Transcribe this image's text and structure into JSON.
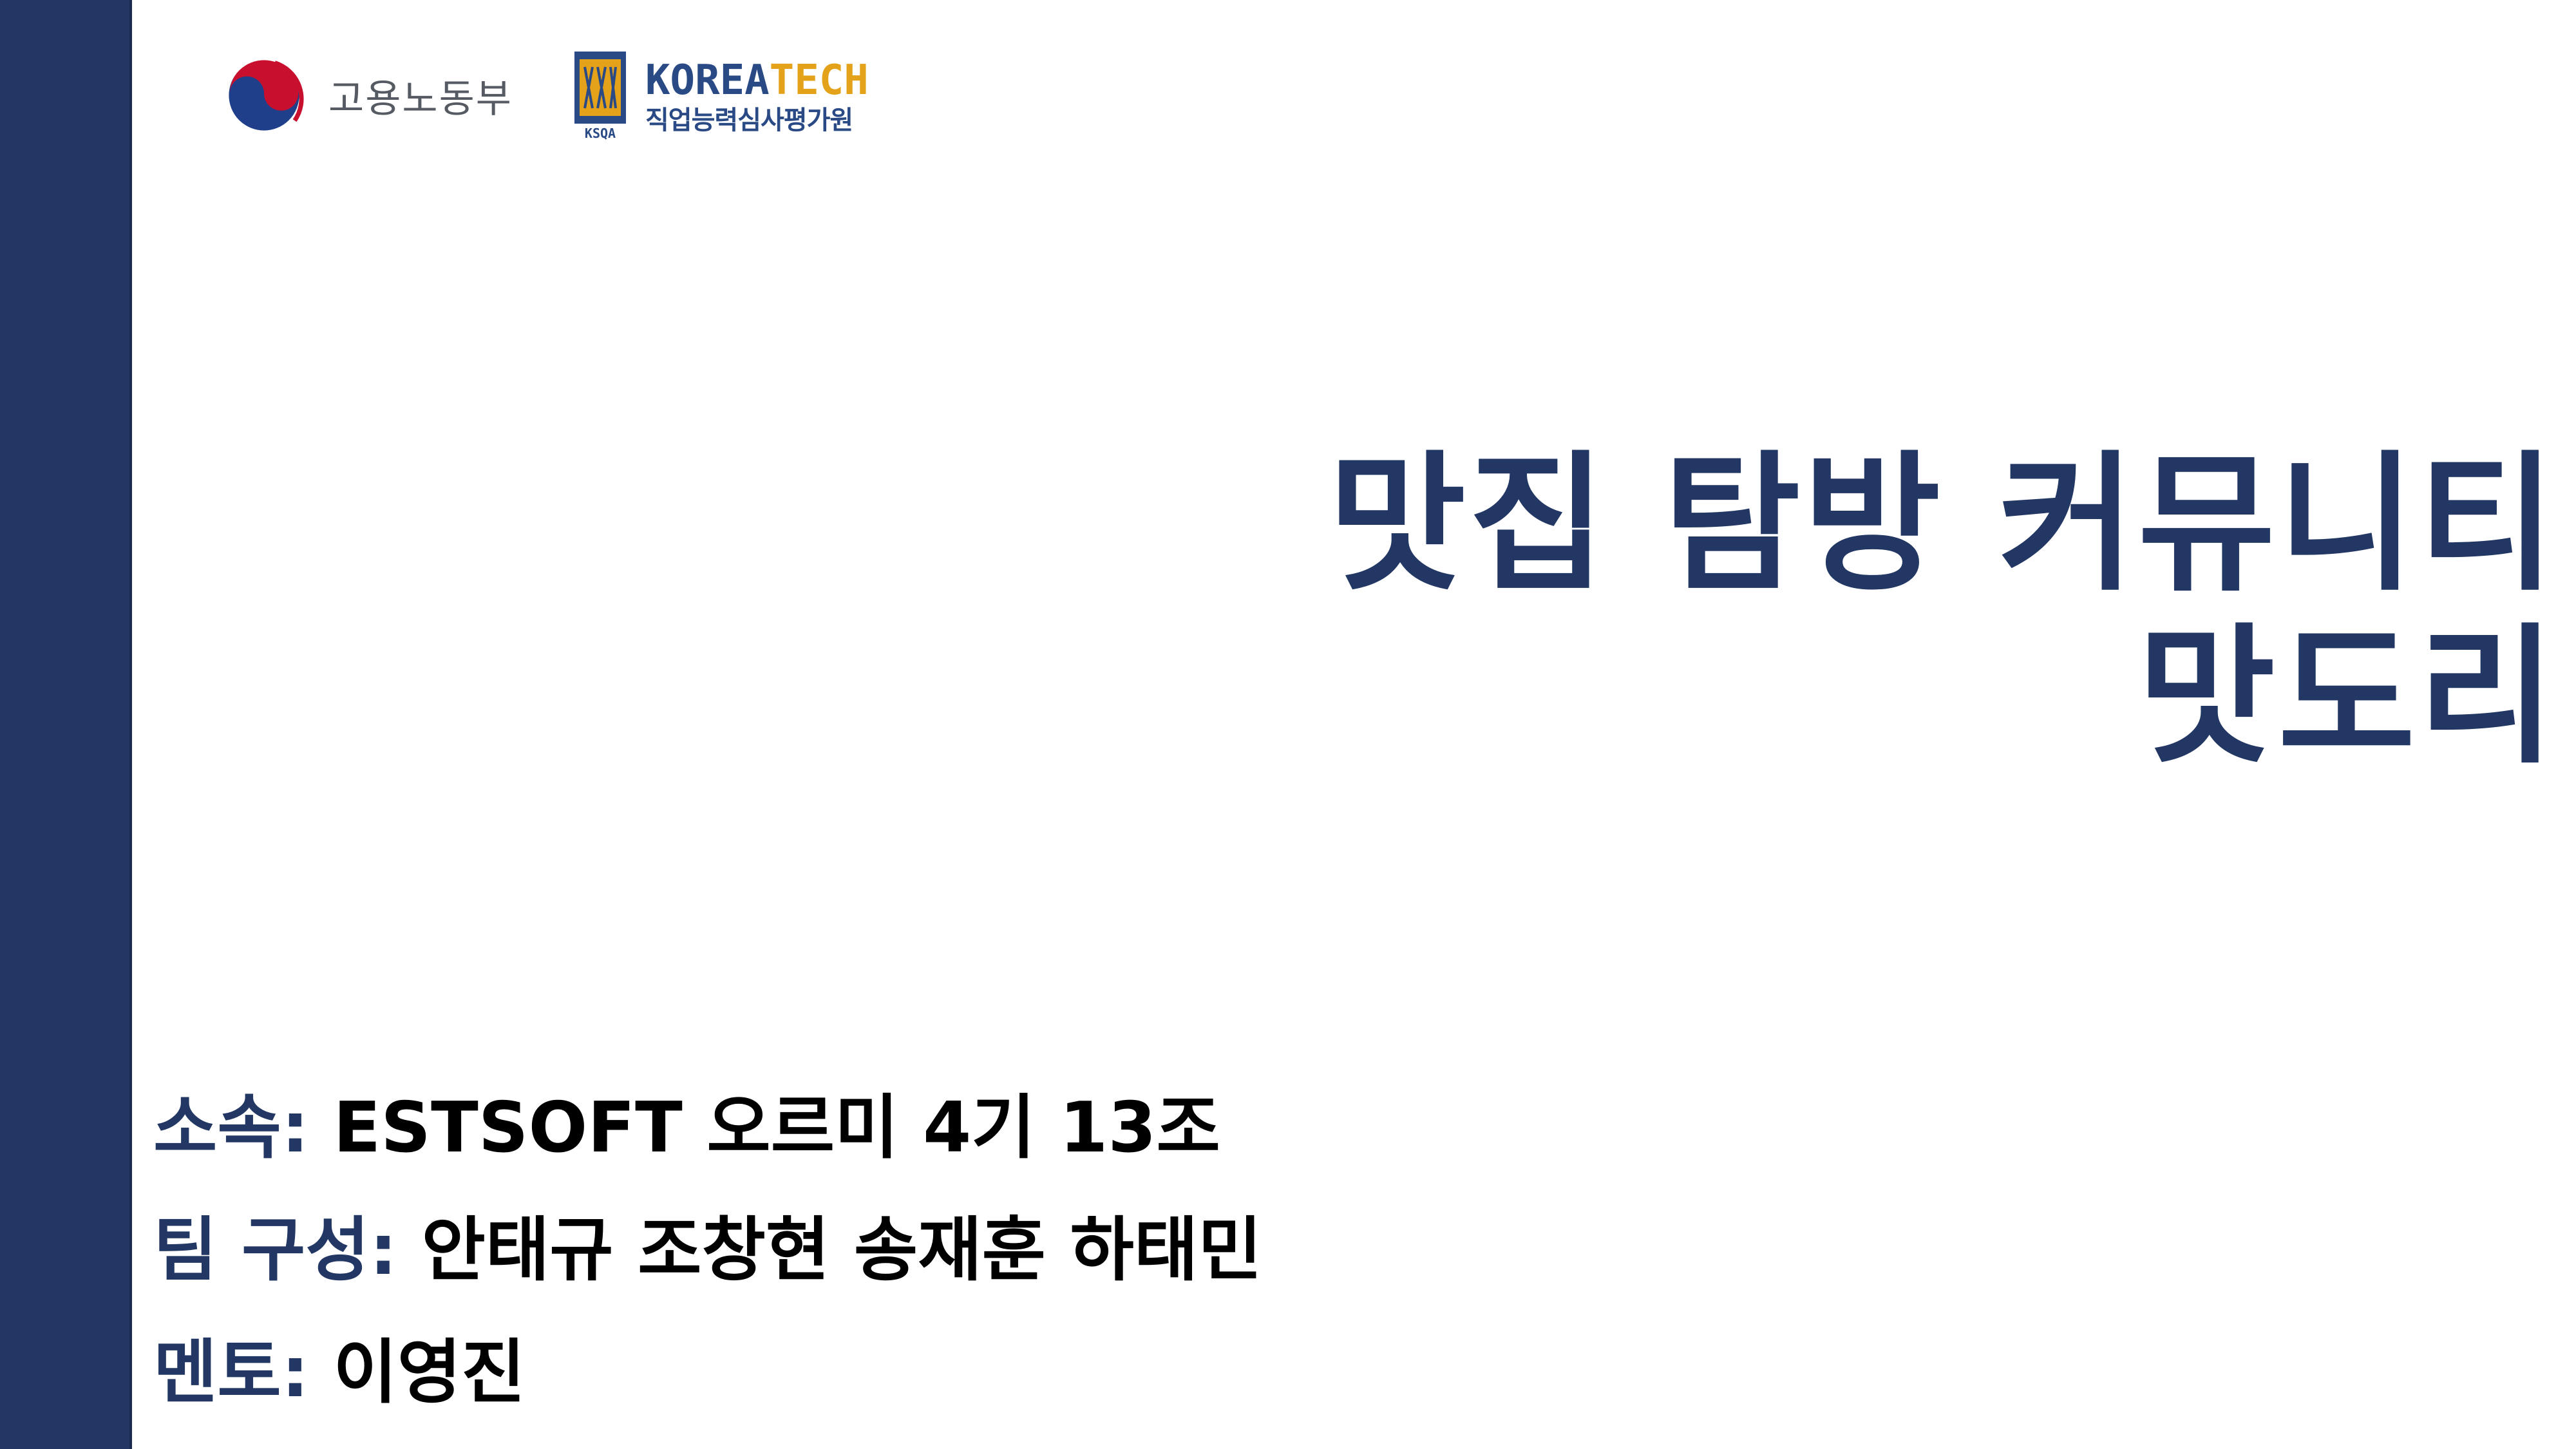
{
  "logos": {
    "moel": {
      "name": "고용노동부"
    },
    "koreatech": {
      "title_part1": "KOREA",
      "title_part2": "TECH",
      "subtitle": "직업능력심사평가원",
      "badge": "KSQA"
    }
  },
  "title": {
    "line1": "맛집 탐방 커뮤니티",
    "line2": "맛도리"
  },
  "info": {
    "affiliation": {
      "label": "소속:",
      "value": "ESTSOFT 오르미 4기 13조"
    },
    "team": {
      "label": "팀 구성:",
      "value": "안태규 조창현 송재훈 하태민"
    },
    "mentor": {
      "label": "멘토:",
      "value": "이영진"
    }
  },
  "colors": {
    "sidebar": "#223764",
    "title": "#223764",
    "label": "#223764",
    "value": "#000000",
    "koreatech_blue": "#2a4a86",
    "koreatech_orange": "#e3a21a"
  }
}
